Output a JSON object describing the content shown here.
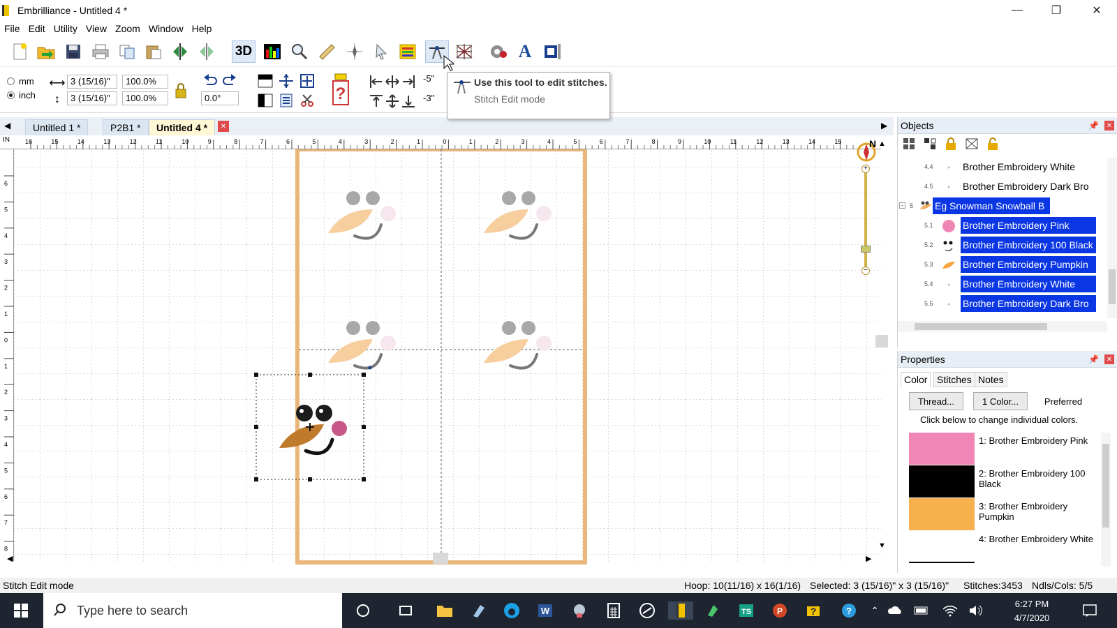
{
  "window": {
    "app": "Embrilliance -",
    "doc": "Untitled 4 *"
  },
  "menu": [
    "File",
    "Edit",
    "Utility",
    "View",
    "Zoom",
    "Window",
    "Help"
  ],
  "toolbar": {
    "btn_3d": "3D",
    "btn_text": "A"
  },
  "units": {
    "mm": "mm",
    "inch": "inch"
  },
  "size": {
    "width": "3 (15/16)\"",
    "height": "3 (15/16)\"",
    "scale_w": "100.0%",
    "scale_h": "100.0%",
    "rotation": "0.0°",
    "offset_x": "-5\"",
    "offset_y": "-3\""
  },
  "tooltip": {
    "title": "Use this tool to edit stitches.",
    "subtitle": "Stitch Edit mode"
  },
  "tabs": [
    {
      "label": "Untitled 1 *"
    },
    {
      "label": "P2B1 *"
    },
    {
      "label": "Untitled 4 *"
    }
  ],
  "ruler": {
    "h_unit": "IN",
    "h_ticks": [
      "16",
      "15",
      "14",
      "13",
      "12",
      "11",
      "10",
      "9",
      "8",
      "7",
      "6",
      "5",
      "4",
      "3",
      "2",
      "1",
      "0",
      "1",
      "2",
      "3",
      "4",
      "5",
      "6",
      "7",
      "8",
      "9",
      "10",
      "11",
      "12",
      "13",
      "14",
      "15"
    ],
    "v_ticks": [
      "6",
      "5",
      "4",
      "3",
      "2",
      "1",
      "0",
      "1",
      "2",
      "3",
      "4",
      "5",
      "6",
      "7",
      "8"
    ],
    "compass": "N"
  },
  "objects": {
    "title": "Objects",
    "rows": [
      {
        "num": "4.4",
        "label": "Brother Embroidery White",
        "selected": false
      },
      {
        "num": "4.5",
        "label": "Brother Embroidery Dark Bro",
        "selected": false
      },
      {
        "num": "5",
        "label": "Eg Snowman Snowball B",
        "selected": true
      },
      {
        "num": "5.1",
        "label": "Brother Embroidery Pink",
        "selected": true
      },
      {
        "num": "5.2",
        "label": "Brother Embroidery 100 Black",
        "selected": true
      },
      {
        "num": "5.3",
        "label": "Brother Embroidery Pumpkin",
        "selected": true
      },
      {
        "num": "5.4",
        "label": "Brother Embroidery White",
        "selected": true
      },
      {
        "num": "5.5",
        "label": "Brother Embroidery Dark Bro",
        "selected": true
      }
    ]
  },
  "properties": {
    "title": "Properties",
    "tabs": [
      "Color",
      "Stitches",
      "Notes"
    ],
    "buttons": [
      "Thread...",
      "1 Color...",
      "Preferred"
    ],
    "hint": "Click below to change individual colors.",
    "colors": [
      {
        "label": "1: Brother Embroidery Pink",
        "hex": "#ef86b6"
      },
      {
        "label": "2: Brother Embroidery 100 Black",
        "hex": "#000000"
      },
      {
        "label": "3: Brother Embroidery Pumpkin",
        "hex": "#f6b04e"
      },
      {
        "label": "4: Brother Embroidery White",
        "hex": "#ffffff"
      }
    ]
  },
  "status": {
    "mode": "Stitch Edit mode",
    "hoop": "Hoop: 10(11/16) x 16(1/16)",
    "selected": "Selected: 3 (15/16)\" x 3 (15/16)\"",
    "stitches": "Stitches:3453",
    "ndls": "Ndls/Cols: 5/5"
  },
  "taskbar": {
    "search_placeholder": "Type here to search",
    "time": "6:27 PM",
    "date": "4/7/2020"
  },
  "design": {
    "colors": {
      "carrot_light": "#f7cf9e",
      "carrot_dark": "#c07a2c",
      "eye_light": "#a8a8a8",
      "eye_dark": "#1c1c1c",
      "cheek": "#c8578a",
      "hoop": "#e9b67c"
    }
  }
}
